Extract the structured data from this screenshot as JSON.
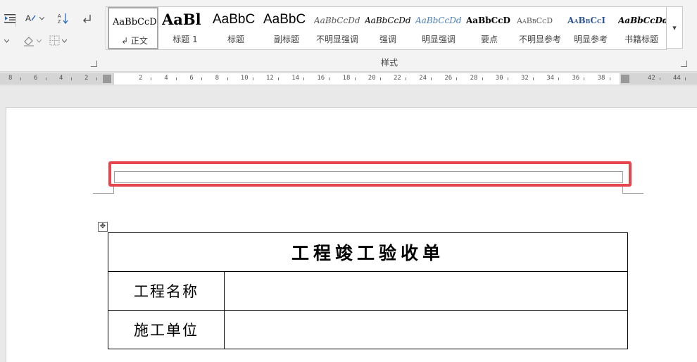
{
  "ribbon": {
    "tools": {
      "indent_icon": "increase-indent-icon",
      "font_case_icon": "change-case-icon",
      "sort_icon": "sort-icon",
      "paragraph_mark_icon": "paragraph-mark-icon",
      "shading_icon": "shading-icon",
      "borders_icon": "borders-icon",
      "sort_glyph": "A↓Z",
      "pilcrow_glyph": "↵"
    },
    "styles_gallery": {
      "items": [
        {
          "sample": "AaBbCcDd",
          "label": "↲ 正文",
          "selected": true
        },
        {
          "sample": "AaBl",
          "label": "标题 1"
        },
        {
          "sample": "AaBbC",
          "label": "标题"
        },
        {
          "sample": "AaBbC",
          "label": "副标题"
        },
        {
          "sample": "AaBbCcDd",
          "label": "不明显强调"
        },
        {
          "sample": "AaBbCcDd",
          "label": "强调"
        },
        {
          "sample": "AaBbCcDd",
          "label": "明显强调"
        },
        {
          "sample": "AaBbCcD",
          "label": "要点"
        },
        {
          "sample": "AaBbCcD",
          "label": "不明显参考"
        },
        {
          "sample": "AaBbCcI",
          "label": "明显参考"
        },
        {
          "sample": "AaBbCcDd",
          "label": "书籍标题"
        }
      ],
      "more_glyph": "▾",
      "group_label": "样式"
    }
  },
  "ruler": {
    "labels_left": [
      "8",
      "6",
      "4",
      "2"
    ],
    "labels_main": [
      "2",
      "4",
      "6",
      "8",
      "10",
      "12",
      "14",
      "16",
      "18",
      "20",
      "22",
      "24",
      "26",
      "28",
      "30",
      "32",
      "34",
      "36",
      "38"
    ],
    "labels_right": [
      "42",
      "44"
    ]
  },
  "document": {
    "table_handle_glyph": "✥",
    "table": {
      "title": "工程竣工验收单",
      "rows": [
        {
          "label": "工程名称",
          "value": ""
        },
        {
          "label": "施工单位",
          "value": ""
        }
      ]
    }
  },
  "colors": {
    "highlight_border": "#e8464f",
    "ribbon_bg": "#f3f3f3",
    "heading_blue": "#2f5597"
  }
}
